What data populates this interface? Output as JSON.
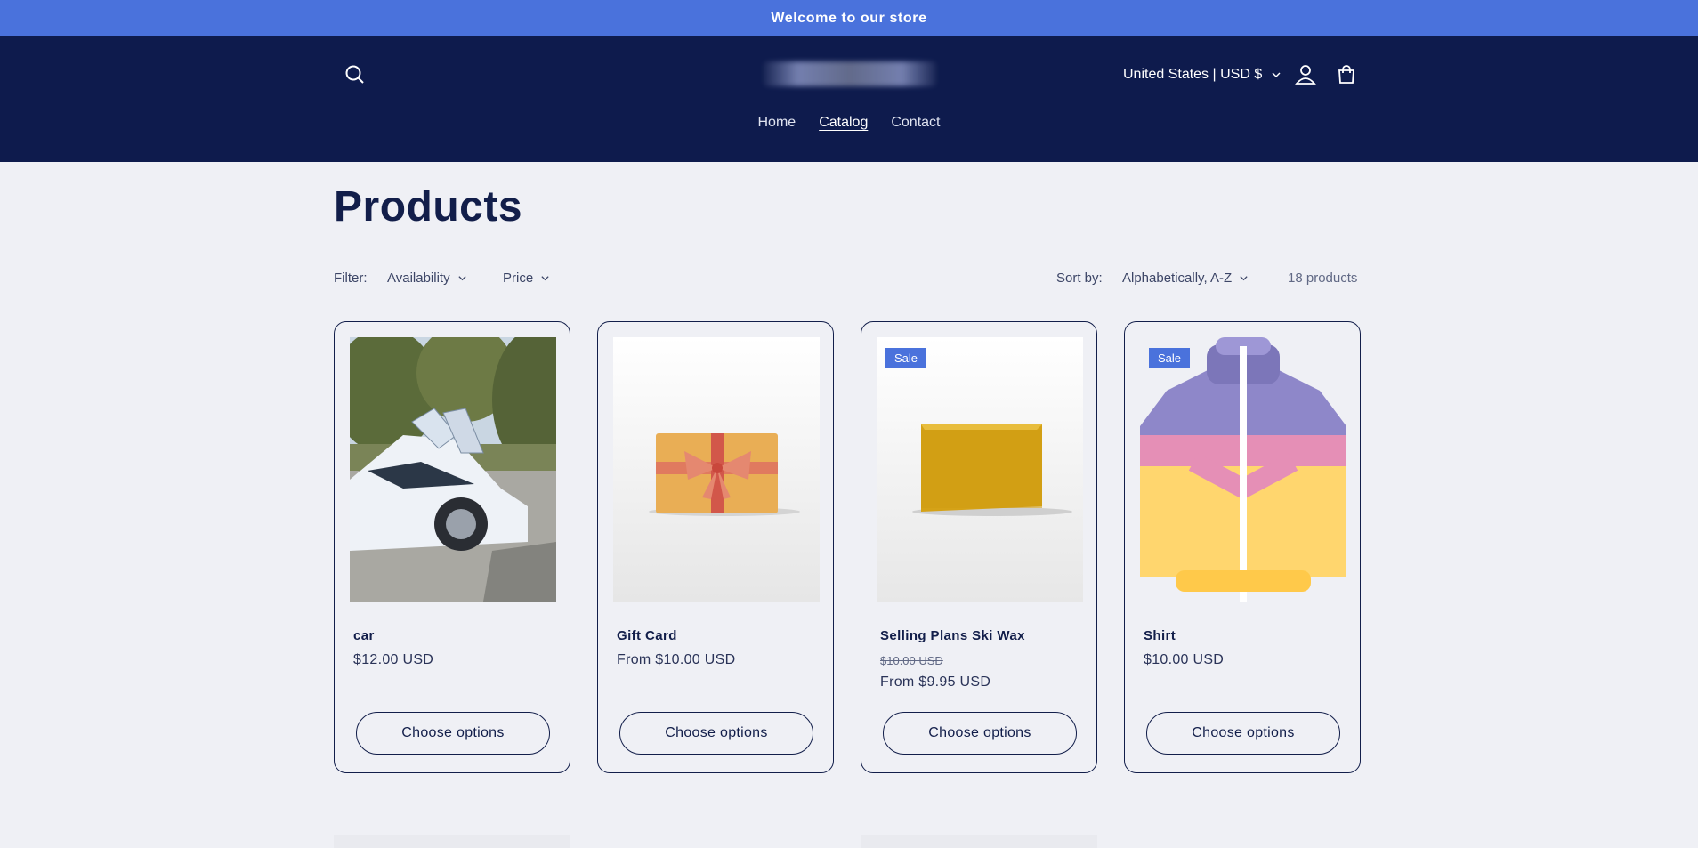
{
  "announcement": "Welcome to our store",
  "header": {
    "country_selector": "United States | USD $",
    "icons": {
      "search": "search-icon",
      "account": "account-icon",
      "cart": "cart-icon"
    }
  },
  "nav": {
    "items": [
      "Home",
      "Catalog",
      "Contact"
    ],
    "active": "Catalog"
  },
  "page": {
    "title": "Products"
  },
  "filters": {
    "label": "Filter:",
    "availability": "Availability",
    "price": "Price",
    "sort_label": "Sort by:",
    "sort_value": "Alphabetically, A-Z",
    "count": "18 products"
  },
  "products": [
    {
      "title": "car",
      "price": "$12.00 USD",
      "button": "Choose options",
      "sale": false
    },
    {
      "title": "Gift Card",
      "price": "From $10.00 USD",
      "button": "Choose options",
      "sale": false
    },
    {
      "title": "Selling Plans Ski Wax",
      "old_price": "$10.00 USD",
      "price": "From $9.95 USD",
      "button": "Choose options",
      "sale": true,
      "badge": "Sale"
    },
    {
      "title": "Shirt",
      "price": "$10.00 USD",
      "button": "Choose options",
      "sale": true,
      "badge": "Sale"
    }
  ],
  "colors": {
    "accent": "#4a72dc",
    "header_bg": "#0e1b4d",
    "text": "#121e4a",
    "page_bg": "#eff0f5"
  }
}
